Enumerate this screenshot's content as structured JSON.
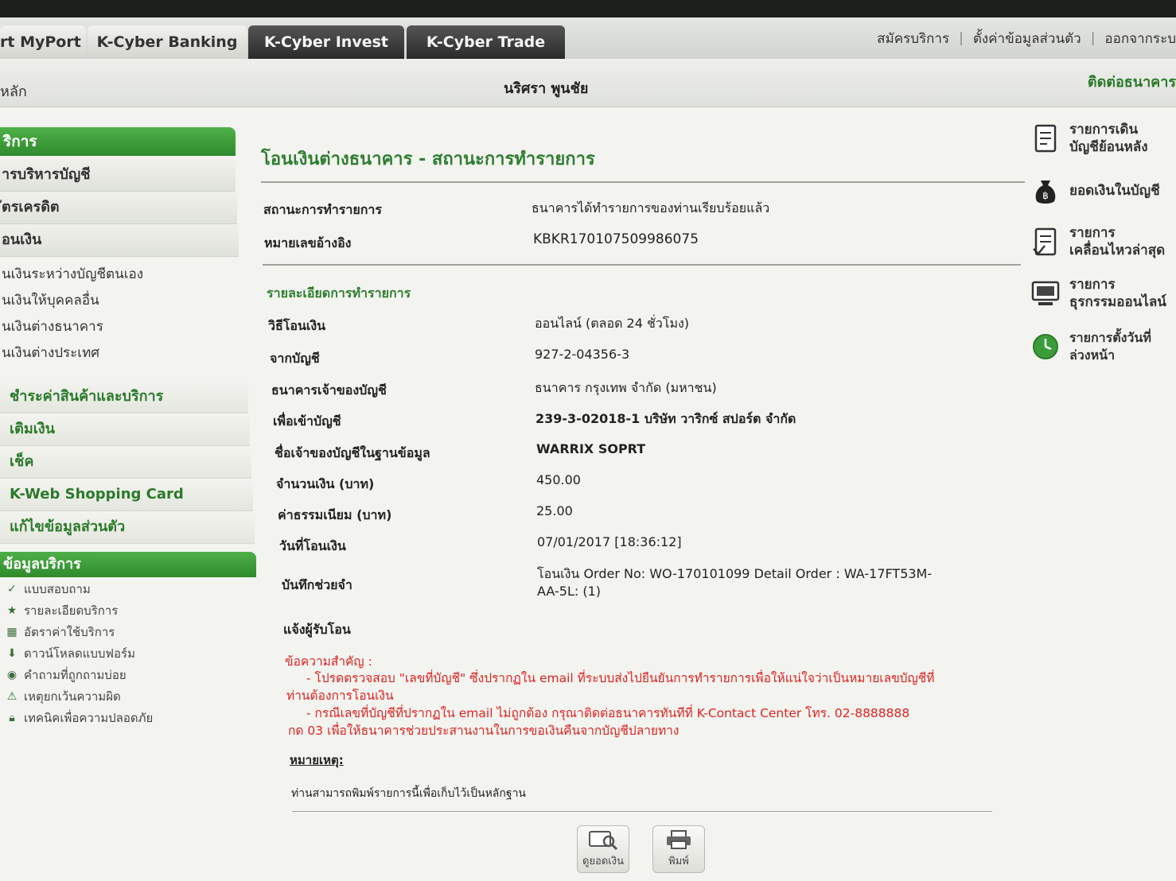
{
  "tabs": [
    "rt MyPort",
    "K-Cyber Banking",
    "K-Cyber Invest",
    "K-Cyber Trade"
  ],
  "top_links": [
    "สมัครบริการ",
    "ตั้งค่าข้อมูลส่วนตัว",
    "ออกจากระบ"
  ],
  "subbar": {
    "home": "หลัก",
    "user": "นริศรา พูนชัย",
    "contact": "ติดต่อธนาคาร"
  },
  "sidebar": {
    "header": "ริการ",
    "main_items": [
      "ารบริหารบัญชี",
      "ัตรเครดิต",
      "อนเงิน"
    ],
    "sub_items": [
      "นเงินระหว่างบัญชีตนเอง",
      "นเงินให้บุคคลอื่น",
      "นเงินต่างธนาคาร",
      "นเงินต่างประเทศ"
    ],
    "group_items": [
      "ชำระค่าสินค้าและบริการ",
      "เติมเงิน",
      "เช็ค",
      "K-Web Shopping Card",
      "แก้ไขข้อมูลส่วนตัว"
    ],
    "info_header": "ข้อมูลบริการ",
    "info_items": [
      {
        "icon": "check-icon",
        "label": "แบบสอบถาม"
      },
      {
        "icon": "star-icon",
        "label": "รายละเอียดบริการ"
      },
      {
        "icon": "calculator-icon",
        "label": "อัตราค่าใช้บริการ"
      },
      {
        "icon": "download-icon",
        "label": "ดาวน์โหลดแบบฟอร์ม"
      },
      {
        "icon": "question-icon",
        "label": "คำถามที่ถูกถามบ่อย"
      },
      {
        "icon": "warning-icon",
        "label": "เหตุยกเว้นความผิด"
      },
      {
        "icon": "lock-icon",
        "label": "เทคนิคเพื่อความปลอดภัย"
      }
    ]
  },
  "content": {
    "title": "โอนเงินต่างธนาคาร - สถานะการทำรายการ",
    "status_label": "สถานะการทำรายการ",
    "status_value": "ธนาคารได้ทำรายการของท่านเรียบร้อยแล้ว",
    "ref_label": "หมายเลขอ้างอิง",
    "ref_value": "KBKR170107509986075",
    "details_title": "รายละเอียดการทำรายการ",
    "details": [
      {
        "label": "วิธีโอนเงิน",
        "value": "ออนไลน์ (ตลอด 24 ชั่วโมง)"
      },
      {
        "label": "จากบัญชี",
        "value": "927-2-04356-3"
      },
      {
        "label": "ธนาคารเจ้าของบัญชี",
        "value": "ธนาคาร กรุงเทพ จำกัด (มหาชน)"
      },
      {
        "label": "เพื่อเข้าบัญชี",
        "value": "239-3-02018-1 บริษัท วาริกซ์ สปอร์ต จำกัด"
      },
      {
        "label": "ชื่อเจ้าของบัญชีในฐานข้อมูล",
        "value": "WARRIX SOPRT"
      },
      {
        "label": "จำนวนเงิน (บาท)",
        "value": "450.00"
      },
      {
        "label": "ค่าธรรมเนียม (บาท)",
        "value": "25.00"
      },
      {
        "label": "วันที่โอนเงิน",
        "value": "07/01/2017 [18:36:12]"
      }
    ],
    "memo_label": "บันทึกช่วยจำ",
    "memo_line1": "โอนเงิน Order No: WO-170101099 Detail Order : WA-17FT53M-",
    "memo_line2": "AA-5L: (1)",
    "notify_label": "แจ้งผู้รับโอน",
    "important_label": "ข้อความสำคัญ :",
    "important_line1": "- โปรดตรวจสอบ \"เลขที่บัญชี\" ซึ่งปรากฏใน email ที่ระบบส่งไปยืนยันการทำรายการเพื่อให้แน่ใจว่าเป็นหมายเลขบัญชีที่",
    "important_line2": "ท่านต้องการโอนเงิน",
    "important_line3": "- กรณีเลขที่บัญชีที่ปรากฏใน email ไม่ถูกต้อง กรุณาติดต่อธนาคารทันทีที่ K-Contact Center โทร. 02-8888888",
    "important_line4": "กด 03 เพื่อให้ธนาคารช่วยประสานงานในการขอเงินคืนจากบัญชีปลายทาง",
    "note_label": "หมายเหตุ:",
    "note_text": "ท่านสามารถพิมพ์รายการนี้เพื่อเก็บไว้เป็นหลักฐาน"
  },
  "right_panel": [
    {
      "icon": "statement-icon",
      "line1": "รายการเดิน",
      "line2": "บัญชีย้อนหลัง"
    },
    {
      "icon": "money-bag-icon",
      "line1": "ยอดเงินในบัญชี",
      "line2": ""
    },
    {
      "icon": "recent-transactions-icon",
      "line1": "รายการ",
      "line2": "เคลื่อนไหวล่าสุด"
    },
    {
      "icon": "computer-icon",
      "line1": "รายการ",
      "line2": "ธุรกรรมออนไลน์"
    },
    {
      "icon": "clock-icon",
      "line1": "รายการตั้งวันที่",
      "line2": "ล่วงหน้า"
    }
  ],
  "buttons": {
    "balance": "ดูยอดเงิน",
    "print": "พิมพ์"
  },
  "colors": {
    "brand_green": "#2e7d32",
    "warning_red": "#dd2222",
    "tab_dark": "#2b2b2b"
  }
}
